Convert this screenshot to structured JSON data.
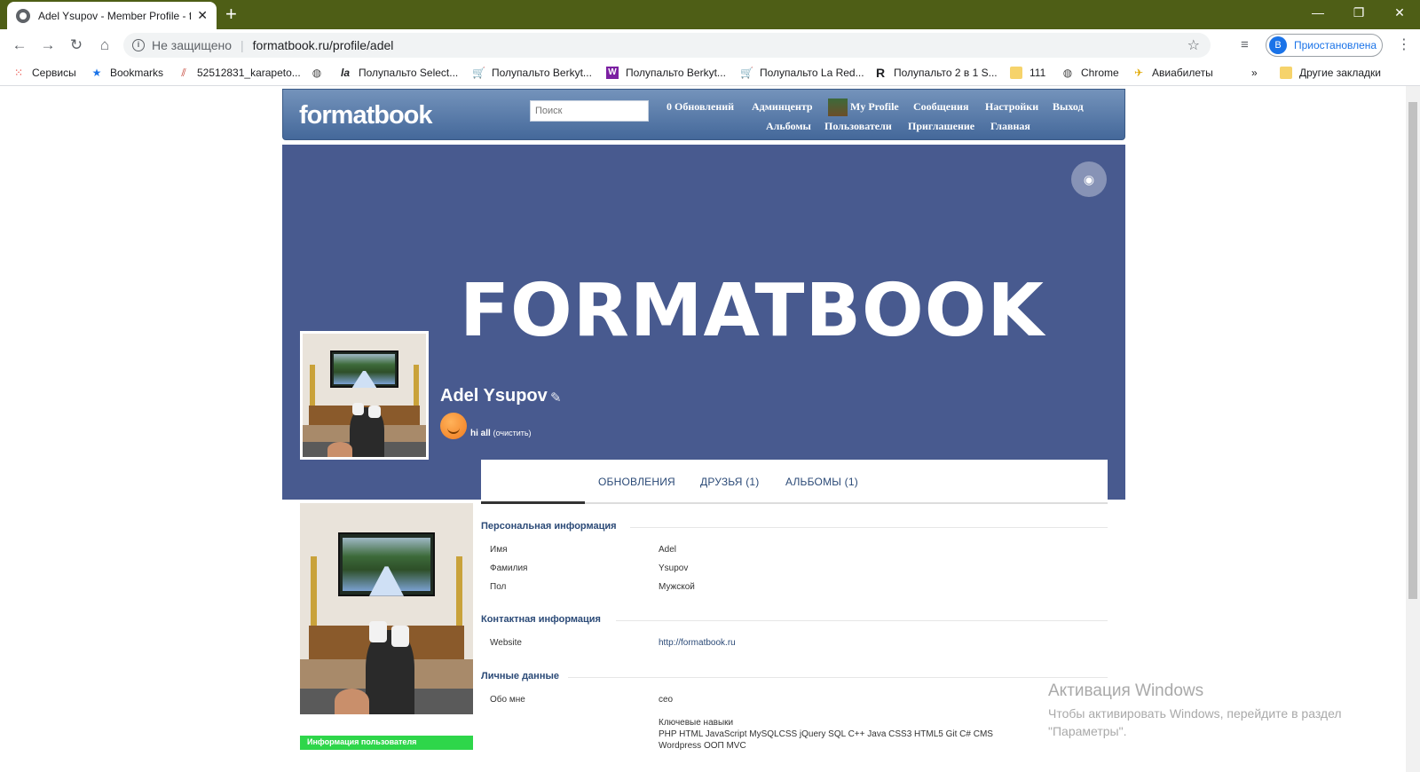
{
  "browser": {
    "tab_title": "Adel Ysupov - Member Profile - f",
    "new_tab": "+",
    "address": {
      "security": "Не защищено",
      "separator": "|",
      "url": "formatbook.ru/profile/adel"
    },
    "profile_initial": "В",
    "profile_status": "Приостановлена",
    "bookmarks": [
      {
        "label": "Сервисы",
        "icon": "apps-grid-icon"
      },
      {
        "label": "Bookmarks",
        "icon": "star-icon"
      },
      {
        "label": "52512831_karapeto...",
        "icon": "stripes-icon"
      },
      {
        "label": "",
        "icon": "globe-icon"
      },
      {
        "label": "Полупальто Select...",
        "icon": "la-icon",
        "icon_text": "la"
      },
      {
        "label": "Полупальто Berkyt...",
        "icon": "cart-icon"
      },
      {
        "label": "Полупальто Berkyt...",
        "icon": "w-icon",
        "icon_text": "W"
      },
      {
        "label": "Полупальто La Red...",
        "icon": "cart-icon"
      },
      {
        "label": "Полупальто 2 в 1 S...",
        "icon": "r-icon",
        "icon_text": "R"
      },
      {
        "label": "111",
        "icon": "folder-icon"
      },
      {
        "label": "Chrome",
        "icon": "globe-icon"
      },
      {
        "label": "Авиабилеты",
        "icon": "plane-icon"
      },
      {
        "label": "»",
        "icon": ""
      },
      {
        "label": "Другие закладки",
        "icon": "folder-icon"
      }
    ]
  },
  "site": {
    "logo": "formatbook",
    "search_placeholder": "Поиск",
    "nav_top": [
      "0 Обновлений",
      "Админцентр",
      "My Profile",
      "Сообщения",
      "Настройки",
      "Выход"
    ],
    "nav_bottom": [
      "Альбомы",
      "Пользователи",
      "Приглашение",
      "Главная"
    ]
  },
  "profile": {
    "cover_text": "FORMATBOOK",
    "name": "Adel Ysupov",
    "status": "hi all",
    "status_clear": "(очистить)",
    "tabs": [
      "ОБНОВЛЕНИЯ",
      "ДРУЗЬЯ (1)",
      "АЛЬБОМЫ (1)"
    ],
    "info_button": "Информация пользователя",
    "sections": {
      "personal": {
        "title": "Персональная информация",
        "rows": [
          {
            "label": "Имя",
            "value": "Adel"
          },
          {
            "label": "Фамилия",
            "value": "Ysupov"
          },
          {
            "label": "Пол",
            "value": "Мужской"
          }
        ]
      },
      "contact": {
        "title": "Контактная информация",
        "rows": [
          {
            "label": "Website",
            "value": "http://formatbook.ru"
          }
        ]
      },
      "private": {
        "title": "Личные данные",
        "about_label": "Обо мне",
        "about_value": "ceo",
        "skills_title": "Ключевые навыки",
        "skills_line1": "PHP HTML JavaScript MySQLCSS jQuery SQL C++ Java CSS3 HTML5 Git C# CMS",
        "skills_line2": "Wordpress ООП MVC"
      }
    }
  },
  "watermark": {
    "title": "Активация Windows",
    "line1": "Чтобы активировать Windows, перейдите в раздел",
    "line2": "\"Параметры\"."
  },
  "colors": {
    "titlebar": "#4e5e16",
    "cover": "#485a8f",
    "accent": "#2b4a77",
    "info_button": "#2ed64a"
  }
}
